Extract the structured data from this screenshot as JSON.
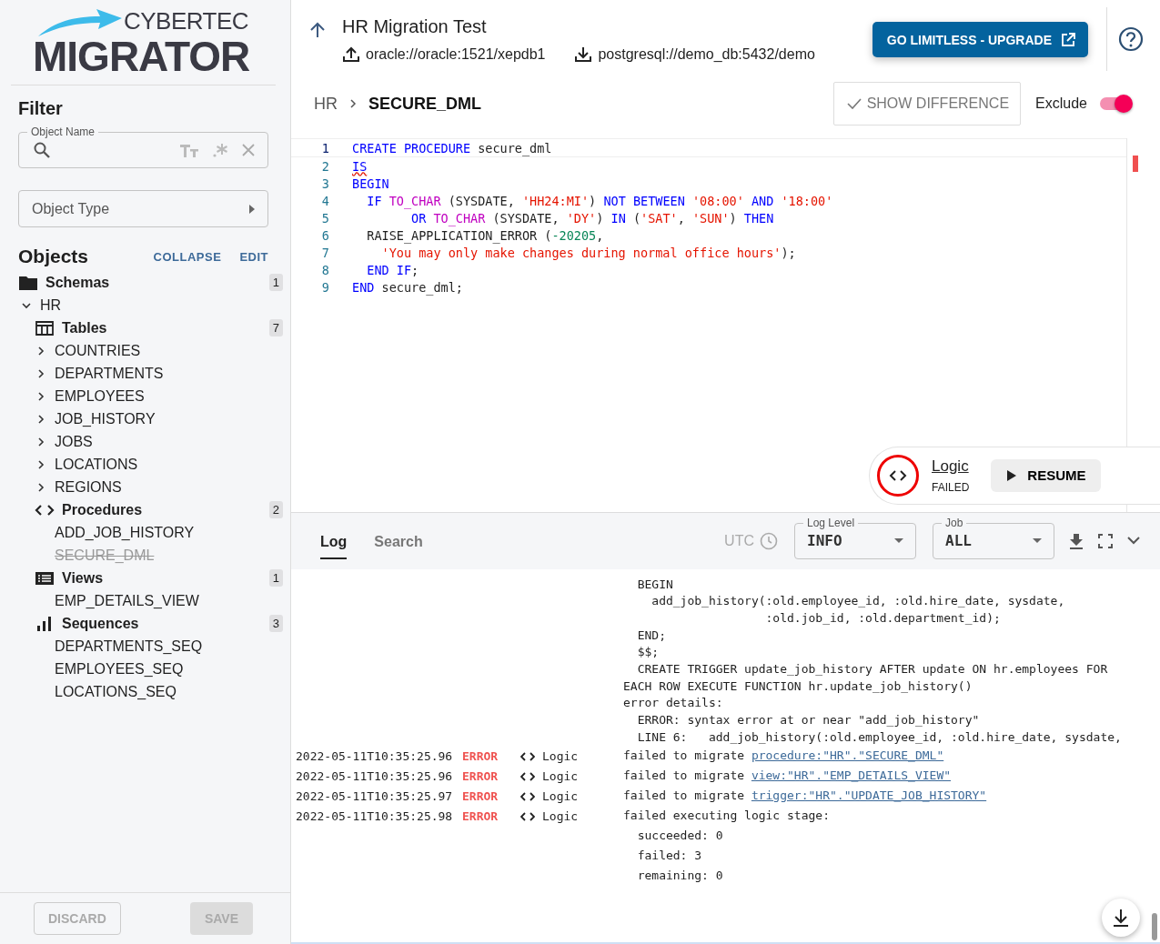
{
  "logo": {
    "top": "CYBERTEC",
    "main": "MIGRATOR"
  },
  "filter": {
    "title": "Filter",
    "name_field": {
      "label": "Object Name"
    },
    "type_select": {
      "placeholder": "Object Type"
    }
  },
  "objects": {
    "title": "Objects",
    "actions": [
      "COLLAPSE",
      "EDIT"
    ],
    "tree": [
      {
        "label": "Schemas",
        "kind": "folder",
        "count": "1",
        "children": [
          {
            "label": "HR",
            "kind": "schema",
            "expanded": true,
            "children": [
              {
                "label": "Tables",
                "kind": "table",
                "count": "7",
                "children": [
                  {
                    "label": "COUNTRIES",
                    "kind": "object",
                    "expanded": false,
                    "excluded": false
                  },
                  {
                    "label": "DEPARTMENTS",
                    "kind": "object",
                    "expanded": false,
                    "excluded": false
                  },
                  {
                    "label": "EMPLOYEES",
                    "kind": "object",
                    "expanded": false,
                    "excluded": false
                  },
                  {
                    "label": "JOB_HISTORY",
                    "kind": "object",
                    "expanded": false,
                    "excluded": false
                  },
                  {
                    "label": "JOBS",
                    "kind": "object",
                    "expanded": false,
                    "excluded": false
                  },
                  {
                    "label": "LOCATIONS",
                    "kind": "object",
                    "expanded": false,
                    "excluded": false
                  },
                  {
                    "label": "REGIONS",
                    "kind": "object",
                    "expanded": false,
                    "excluded": false
                  }
                ]
              },
              {
                "label": "Procedures",
                "kind": "code",
                "count": "2",
                "children": [
                  {
                    "label": "ADD_JOB_HISTORY",
                    "kind": "object",
                    "excluded": false
                  },
                  {
                    "label": "SECURE_DML",
                    "kind": "object",
                    "excluded": true
                  }
                ]
              },
              {
                "label": "Views",
                "kind": "list",
                "count": "1",
                "children": [
                  {
                    "label": "EMP_DETAILS_VIEW",
                    "kind": "object",
                    "excluded": false
                  }
                ]
              },
              {
                "label": "Sequences",
                "kind": "bars",
                "count": "3",
                "children": [
                  {
                    "label": "DEPARTMENTS_SEQ",
                    "kind": "object",
                    "excluded": false
                  },
                  {
                    "label": "EMPLOYEES_SEQ",
                    "kind": "object",
                    "excluded": false
                  },
                  {
                    "label": "LOCATIONS_SEQ",
                    "kind": "object",
                    "excluded": false
                  }
                ]
              }
            ]
          }
        ]
      }
    ]
  },
  "footer_buttons": [
    {
      "label": "DISCARD",
      "kind": "outlined",
      "disabled": true
    },
    {
      "label": "SAVE",
      "kind": "filled",
      "disabled": true
    }
  ],
  "header": {
    "title": "HR Migration Test",
    "source": "oracle://oracle:1521/xepdb1",
    "target": "postgresql://demo_db:5432/demo",
    "upgrade_button": "GO LIMITLESS - UPGRADE"
  },
  "breadcrumb": [
    "HR",
    "SECURE_DML"
  ],
  "show_difference_button": "SHOW DIFFERENCE",
  "exclude_toggle": {
    "label": "Exclude",
    "on": true
  },
  "code": [
    {
      "number": "1",
      "tokens": [
        {
          "text": "CREATE PROCEDURE ",
          "kind": "keyword"
        },
        {
          "text": "secure_dml",
          "kind": "plain"
        }
      ]
    },
    {
      "number": "2",
      "tokens": [
        {
          "text": "IS",
          "kind": "error"
        }
      ]
    },
    {
      "number": "3",
      "tokens": [
        {
          "text": "BEGIN",
          "kind": "keyword"
        }
      ]
    },
    {
      "number": "4",
      "tokens": [
        {
          "text": "  IF ",
          "kind": "keyword"
        },
        {
          "text": "TO_CHAR",
          "kind": "func"
        },
        {
          "text": " (SYSDATE, ",
          "kind": "plain"
        },
        {
          "text": "'HH24:MI'",
          "kind": "string"
        },
        {
          "text": ") ",
          "kind": "plain"
        },
        {
          "text": "NOT BETWEEN ",
          "kind": "keyword"
        },
        {
          "text": "'08:00' ",
          "kind": "string"
        },
        {
          "text": "AND ",
          "kind": "keyword"
        },
        {
          "text": "'18:00'",
          "kind": "string"
        }
      ]
    },
    {
      "number": "5",
      "tokens": [
        {
          "text": "        OR ",
          "kind": "keyword"
        },
        {
          "text": "TO_CHAR",
          "kind": "func"
        },
        {
          "text": " (SYSDATE, ",
          "kind": "plain"
        },
        {
          "text": "'DY'",
          "kind": "string"
        },
        {
          "text": ") ",
          "kind": "plain"
        },
        {
          "text": "IN ",
          "kind": "keyword"
        },
        {
          "text": "(",
          "kind": "plain"
        },
        {
          "text": "'SAT'",
          "kind": "string"
        },
        {
          "text": ", ",
          "kind": "plain"
        },
        {
          "text": "'SUN'",
          "kind": "string"
        },
        {
          "text": ") ",
          "kind": "plain"
        },
        {
          "text": "THEN",
          "kind": "keyword"
        }
      ]
    },
    {
      "number": "6",
      "tokens": [
        {
          "text": "  RAISE_APPLICATION_ERROR (",
          "kind": "plain"
        },
        {
          "text": "-20205",
          "kind": "number"
        },
        {
          "text": ",",
          "kind": "plain"
        }
      ]
    },
    {
      "number": "7",
      "tokens": [
        {
          "text": "    'You may only make changes during normal office hours'",
          "kind": "string"
        },
        {
          "text": ");",
          "kind": "plain"
        }
      ]
    },
    {
      "number": "8",
      "tokens": [
        {
          "text": "  END IF",
          "kind": "keyword"
        },
        {
          "text": ";",
          "kind": "plain"
        }
      ]
    },
    {
      "number": "9",
      "tokens": [
        {
          "text": "END ",
          "kind": "keyword"
        },
        {
          "text": "secure_dml;",
          "kind": "plain"
        }
      ]
    }
  ],
  "stage_card": {
    "stage": "Logic",
    "status": "FAILED",
    "button": "RESUME"
  },
  "log_tabs": [
    {
      "label": "Log",
      "selected": true
    },
    {
      "label": "Search",
      "selected": false
    }
  ],
  "utc_label": "UTC",
  "log_level_select": {
    "label": "Log Level",
    "value": "INFO"
  },
  "job_select": {
    "label": "Job",
    "value": "ALL"
  },
  "log_rows": [
    {
      "more": [
        "  BEGIN",
        "    add_job_history(:old.employee_id, :old.hire_date, sysdate,",
        "                    :old.job_id, :old.department_id);",
        "  END;",
        "  $$;",
        "  CREATE TRIGGER update_job_history AFTER update ON hr.employees FOR",
        "EACH ROW EXECUTE FUNCTION hr.update_job_history()",
        "error details:",
        "  ERROR: syntax error at or near \"add_job_history\"",
        "  LINE 6:   add_job_history(:old.employee_id, :old.hire_date, sysdate,"
      ]
    },
    {
      "time": "2022-05-11T10:35:25.96",
      "level": "ERROR",
      "source": "Logic",
      "text": "failed to migrate",
      "link": "procedure:\"HR\".\"SECURE_DML\""
    },
    {
      "time": "2022-05-11T10:35:25.96",
      "level": "ERROR",
      "source": "Logic",
      "text": "failed to migrate",
      "link": "view:\"HR\".\"EMP_DETAILS_VIEW\""
    },
    {
      "time": "2022-05-11T10:35:25.97",
      "level": "ERROR",
      "source": "Logic",
      "text": "failed to migrate",
      "link": "trigger:\"HR\".\"UPDATE_JOB_HISTORY\""
    },
    {
      "time": "2022-05-11T10:35:25.98",
      "level": "ERROR",
      "source": "Logic",
      "text": "failed executing logic stage:",
      "more": [
        "  succeeded: 0",
        "  failed: 3",
        "  remaining: 0"
      ]
    }
  ]
}
